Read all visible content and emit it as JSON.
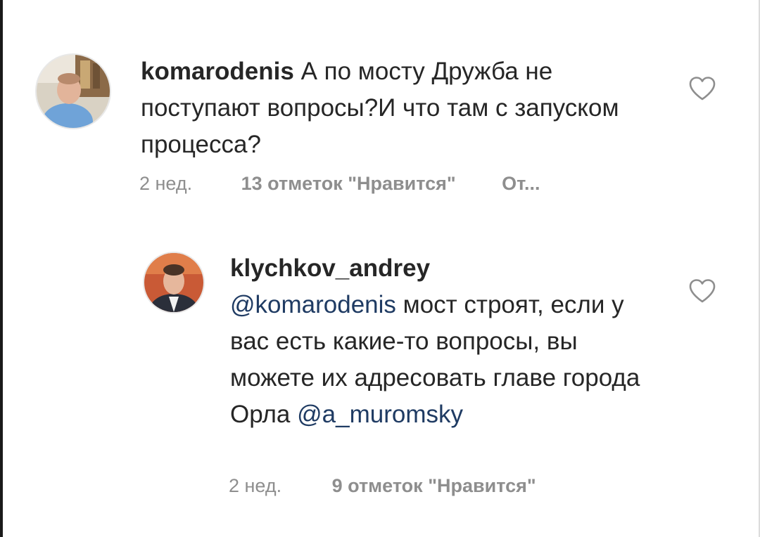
{
  "comments": [
    {
      "username": "komarodenis",
      "text": " А по мосту Дружба не поступают вопросы?И что там с запуском процесса?",
      "time": "2 нед.",
      "likes": "13 отметок \"Нравится\"",
      "reply": "От..."
    }
  ],
  "replies": [
    {
      "username": "klychkov_andrey",
      "mention1": "@komarodenis",
      "text1": " мост строят, если у вас есть какие-то вопросы, вы можете их адресовать главе города Орла",
      "mention2": "@a_muromsky",
      "time": "2 нед.",
      "likes": "9 отметок \"Нравится\""
    }
  ],
  "colors": {
    "mention": "#1f3b63",
    "meta": "#8e8e8e",
    "text": "#262626"
  },
  "icons": {
    "like": "heart-outline-icon"
  }
}
